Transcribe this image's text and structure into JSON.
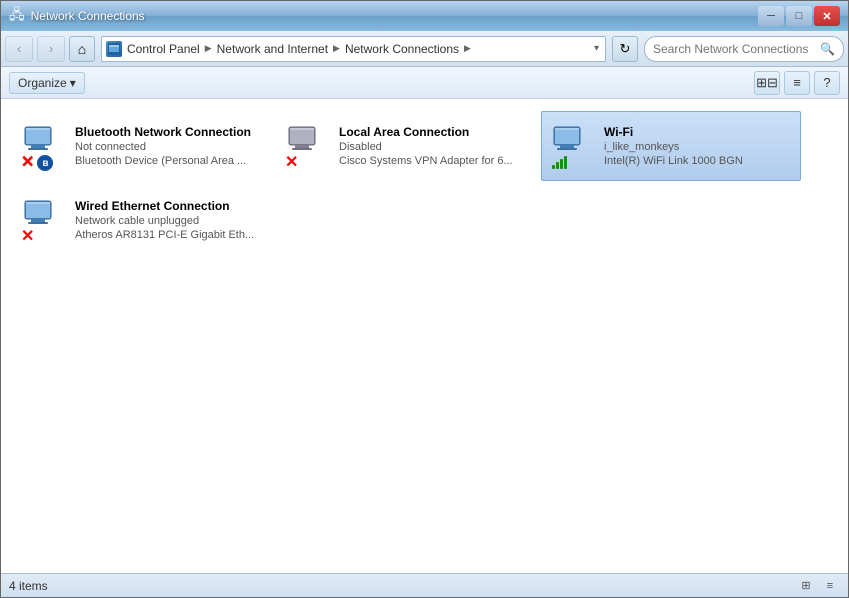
{
  "titleBar": {
    "title": "Network Connections",
    "icon": "🖧",
    "minLabel": "─",
    "maxLabel": "□",
    "closeLabel": "✕"
  },
  "navBar": {
    "backLabel": "‹",
    "forwardLabel": "›",
    "homeLabel": "⌂",
    "refreshLabel": "↻",
    "breadcrumb": [
      {
        "label": "Control Panel",
        "hasArrow": true
      },
      {
        "label": "Network and Internet",
        "hasArrow": true
      },
      {
        "label": "Network Connections",
        "hasArrow": true
      }
    ],
    "searchPlaceholder": "Search Network Connections"
  },
  "toolbar": {
    "organizeLabel": "Organize",
    "organizeArrow": "▾",
    "viewToggle1": "⊞",
    "viewToggle2": "≡",
    "helpLabel": "?"
  },
  "networkItems": [
    {
      "id": "bluetooth",
      "name": "Bluetooth Network Connection",
      "status": "Not connected",
      "description": "Bluetooth Device (Personal Area ...",
      "type": "bluetooth",
      "connected": false,
      "selected": false
    },
    {
      "id": "local-area",
      "name": "Local Area Connection",
      "status": "Disabled",
      "description": "Cisco Systems VPN Adapter for 6...",
      "type": "ethernet",
      "connected": false,
      "selected": false
    },
    {
      "id": "wifi",
      "name": "Wi-Fi",
      "status": "i_like_monkeys",
      "description": "Intel(R) WiFi Link 1000 BGN",
      "type": "wifi",
      "connected": true,
      "selected": true
    },
    {
      "id": "wired",
      "name": "Wired Ethernet Connection",
      "status": "Network cable unplugged",
      "description": "Atheros AR8131 PCI-E Gigabit Eth...",
      "type": "ethernet",
      "connected": false,
      "selected": false
    }
  ],
  "statusBar": {
    "itemCount": "4 items"
  }
}
